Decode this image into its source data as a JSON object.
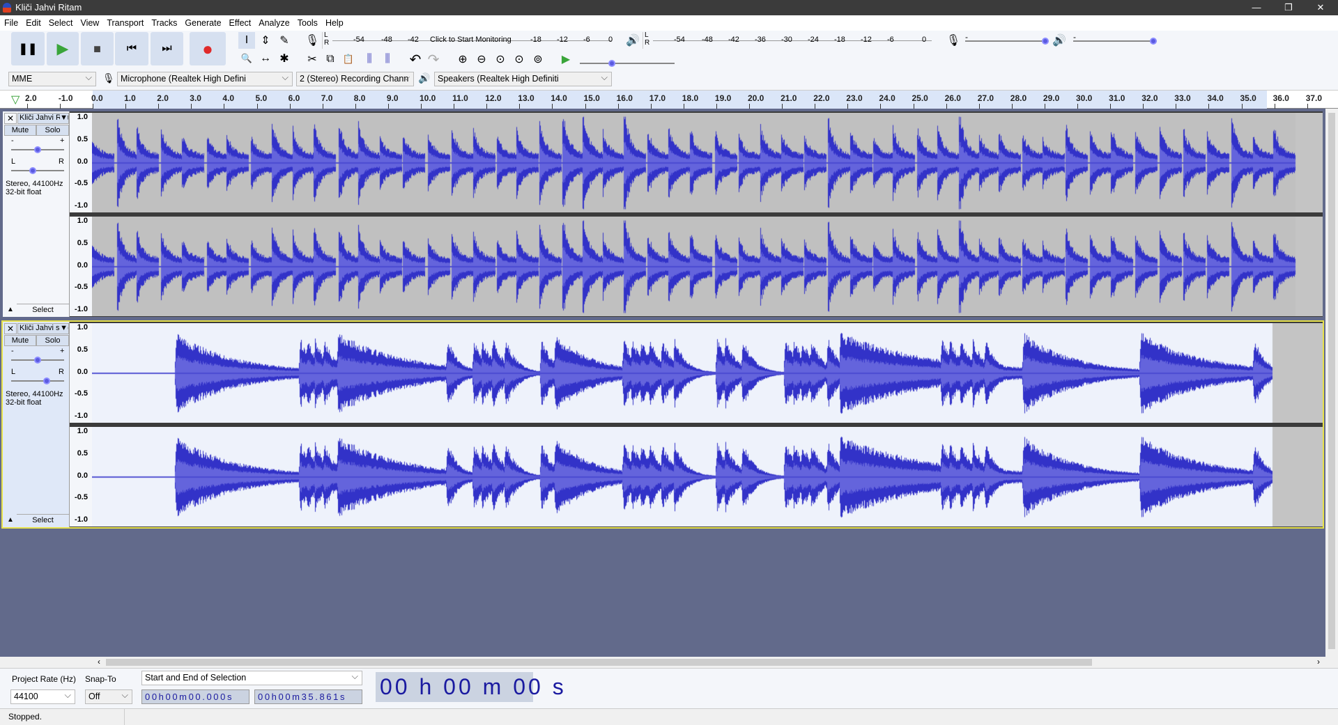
{
  "window": {
    "title": "Kliči Jahvi Ritam",
    "minimize": "—",
    "restore": "❐",
    "close": "✕"
  },
  "menu": [
    "File",
    "Edit",
    "Select",
    "View",
    "Transport",
    "Tracks",
    "Generate",
    "Effect",
    "Analyze",
    "Tools",
    "Help"
  ],
  "transport": {
    "pause": "❚❚",
    "play": "▶",
    "stop": "■",
    "skip_start": "⏮",
    "skip_end": "⏭",
    "record": "●"
  },
  "tools": [
    "I",
    "⇕",
    "✎",
    "🔍",
    "↔",
    "✱"
  ],
  "edit_tools": [
    "✂",
    "⧉",
    "📋",
    "⫼",
    "⫼",
    "↶",
    "↷",
    "⊕",
    "⊖",
    "⊙",
    "⊙",
    "⊚"
  ],
  "record_meter": {
    "labels": [
      "-54",
      "-48",
      "-42",
      "Click to Start Monitoring",
      "-18",
      "-12",
      "-6",
      "0"
    ],
    "lr": "L\nR"
  },
  "play_meter": {
    "labels": [
      "-54",
      "-48",
      "-42",
      "-36",
      "-30",
      "-24",
      "-18",
      "-12",
      "-6",
      "0"
    ]
  },
  "mixer": {
    "minus": "-",
    "plus": "+",
    "record_volume": 1.0,
    "playback_volume": 1.0
  },
  "play_at_speed": {
    "value": 1.0
  },
  "devices": {
    "host": "MME",
    "mic": "Microphone (Realtek High Defini",
    "channels": "2 (Stereo) Recording Chann",
    "speakers": "Speakers (Realtek High Definiti"
  },
  "ruler": {
    "labels": [
      "2.0",
      "-1.0",
      "0.0",
      "1.0",
      "2.0",
      "3.0",
      "4.0",
      "5.0",
      "6.0",
      "7.0",
      "8.0",
      "9.0",
      "10.0",
      "11.0",
      "12.0",
      "13.0",
      "14.0",
      "15.0",
      "16.0",
      "17.0",
      "18.0",
      "19.0",
      "20.0",
      "21.0",
      "22.0",
      "23.0",
      "24.0",
      "25.0",
      "26.0",
      "27.0",
      "28.0",
      "29.0",
      "30.0",
      "31.0",
      "32.0",
      "33.0",
      "34.0",
      "35.0",
      "36.0",
      "37.0"
    ]
  },
  "tracks": [
    {
      "name": "Kliči Jahvi Ritam",
      "mute": "Mute",
      "solo": "Solo",
      "gain_minus": "-",
      "gain_plus": "+",
      "pan_l": "L",
      "pan_r": "R",
      "info1": "Stereo, 44100Hz",
      "info2": "32-bit float",
      "select": "Select",
      "collapse": "▲",
      "close": "✕",
      "menu": "▼",
      "gain": 0.5,
      "pan": 0.4,
      "selected": false
    },
    {
      "name": "Kliči Jahvi sopran",
      "mute": "Mute",
      "solo": "Solo",
      "gain_minus": "-",
      "gain_plus": "+",
      "pan_l": "L",
      "pan_r": "R",
      "info1": "Stereo, 44100Hz",
      "info2": "32-bit float",
      "select": "Select",
      "collapse": "▲",
      "close": "✕",
      "menu": "▼",
      "gain": 0.5,
      "pan": 0.7,
      "selected": true
    }
  ],
  "vruler": [
    "1.0",
    "0.5",
    "0.0",
    "-0.5",
    "-1.0"
  ],
  "colors": {
    "wave": "#3232c8",
    "rms": "#6464dc",
    "track_bg": "#c0c0c0",
    "selected_bg": "#eef2fb",
    "empty": "#626a8b"
  },
  "selection": {
    "project_rate_label": "Project Rate (Hz)",
    "snap_label": "Snap-To",
    "mode": "Start and End of Selection",
    "rate": "44100",
    "snap": "Off",
    "start": "00h00m00.000s",
    "end": "00h00m35.861s",
    "audio_position": "00 h 00 m 00 s"
  },
  "status": "Stopped."
}
